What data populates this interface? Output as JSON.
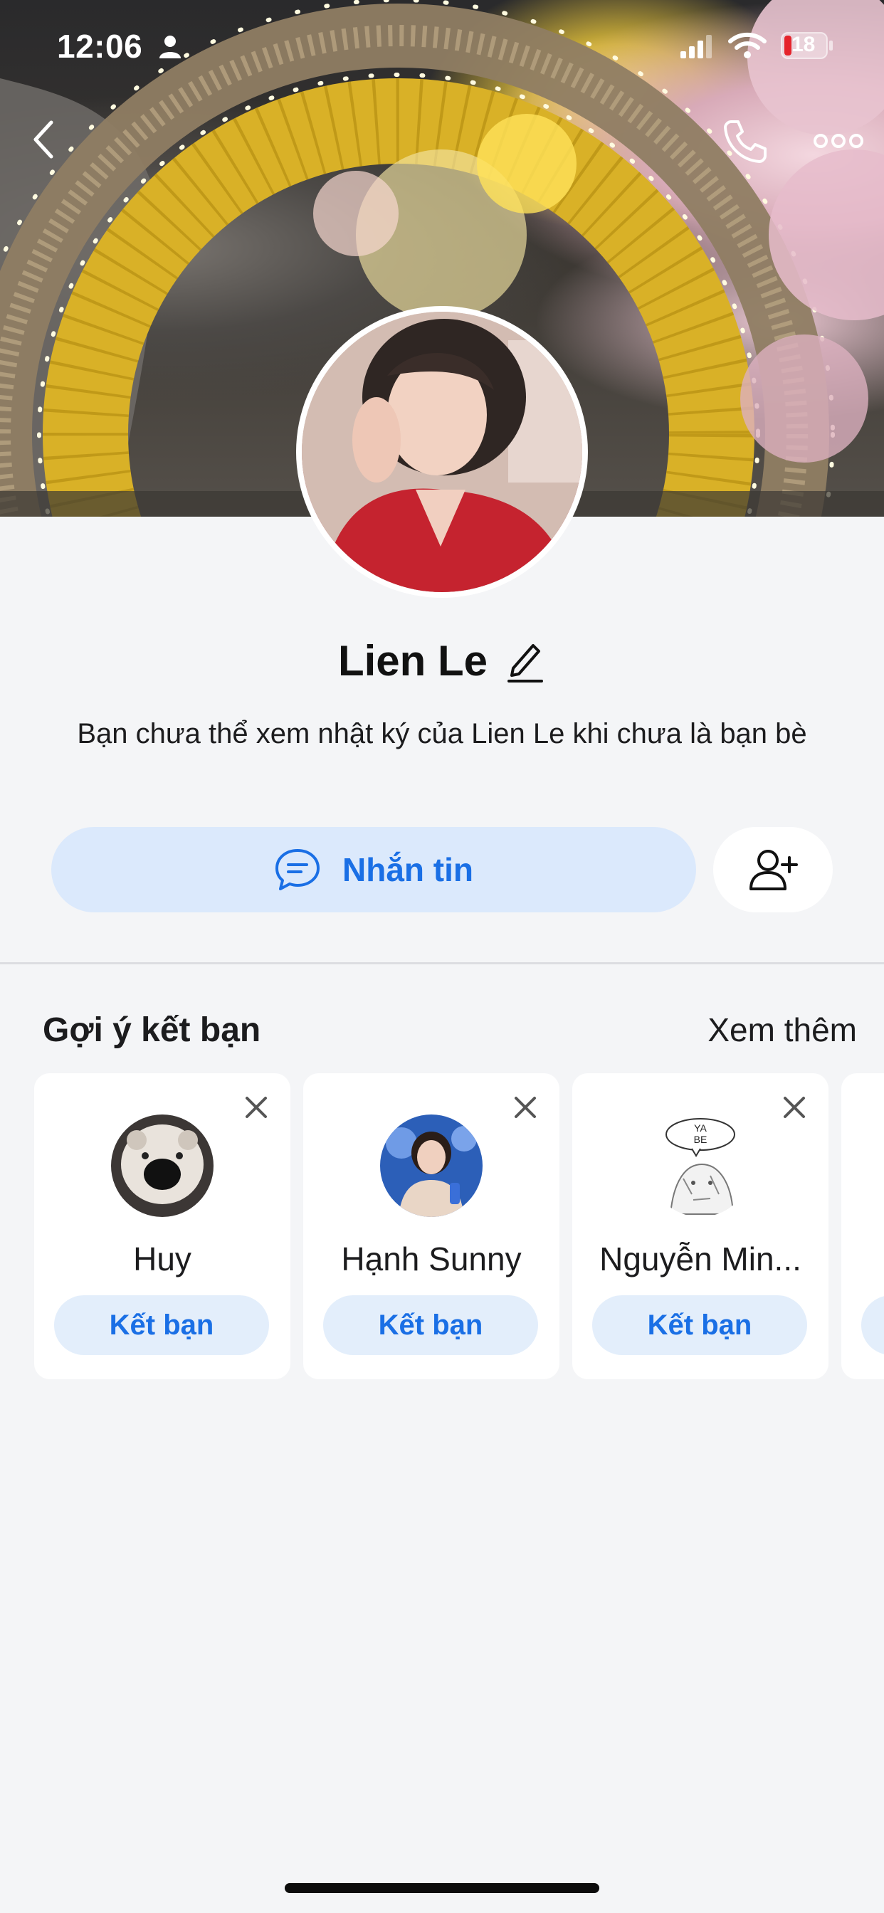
{
  "status_bar": {
    "time": "12:06",
    "battery": "18",
    "icons": [
      "person-icon",
      "signal-icon",
      "wifi-icon",
      "battery-icon"
    ]
  },
  "top_nav": {
    "icons": [
      "chevron-left-icon",
      "phone-icon",
      "more-dots-icon"
    ]
  },
  "profile": {
    "name": "Lien Le",
    "notice": "Bạn chưa thể xem nhật ký của Lien Le khi chưa là bạn bè",
    "message_button": "Nhắn tin",
    "icons": [
      "pencil-icon",
      "chat-bubble-icon",
      "add-friend-icon"
    ]
  },
  "suggestions": {
    "title": "Gợi ý kết bạn",
    "see_more": "Xem thêm",
    "cards": [
      {
        "name": "Huy",
        "button": "Kết bạn"
      },
      {
        "name": "Hạnh Sunny",
        "button": "Kết bạn"
      },
      {
        "name": "Nguyễn Min...",
        "button": "Kết bạn",
        "avatar_text": "YA BE"
      }
    ]
  },
  "colors": {
    "accent": "#1a6fe5",
    "accent_soft": "#dbe9fc",
    "background": "#f4f5f7",
    "battery_low": "#e5232b"
  }
}
